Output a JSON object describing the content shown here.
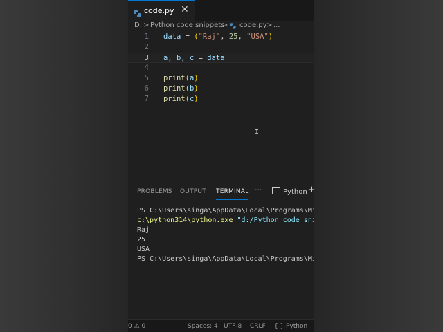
{
  "tab": {
    "filename": "code.py",
    "close": "✕"
  },
  "breadcrumb": {
    "drive": "D:",
    "sep": ">",
    "folder": "Python code snippets",
    "file": "code.py",
    "more": "..."
  },
  "editor": {
    "line_numbers": [
      "1",
      "2",
      "3",
      "4",
      "5",
      "6",
      "7"
    ],
    "current_line": "3",
    "lines": {
      "l1": {
        "var": "data",
        "eq": " = ",
        "open": "(",
        "s1": "\"Raj\"",
        "c1": ", ",
        "num": "25",
        "c2": ", ",
        "s2": "\"USA\"",
        "close": ")"
      },
      "l3": {
        "vars": "a, b, c",
        "eq": " = ",
        "var": "data"
      },
      "l5": {
        "fn": "print",
        "open": "(",
        "arg": "a",
        "close": ")"
      },
      "l6": {
        "fn": "print",
        "open": "(",
        "arg": "b",
        "close": ")"
      },
      "l7": {
        "fn": "print",
        "open": "(",
        "arg": "c",
        "close": ")"
      }
    },
    "mouse_cursor": "I"
  },
  "panel": {
    "tabs": [
      "PROBLEMS",
      "OUTPUT",
      "TERMINAL"
    ],
    "active_tab": "TERMINAL",
    "more": "···",
    "shell": "Python",
    "add": "+"
  },
  "terminal": {
    "prompt1": "PS C:\\Users\\singa\\AppData\\Local\\Programs\\Mic",
    "cmd_exe": "c:\\python314\\python.exe",
    "cmd_arg": " \"d:/Python code snip",
    "out1": "Raj",
    "out2": "25",
    "out3": "USA",
    "prompt2": "PS C:\\Users\\singa\\AppData\\Local\\Programs\\Mic"
  },
  "status": {
    "problems": "0 ⚠ 0",
    "spaces": "Spaces: 4",
    "encoding": "UTF-8",
    "eol": "CRLF",
    "braces": "{ }",
    "language": "Python"
  },
  "colors": {
    "accent": "#0078d4",
    "editor_bg": "#1f1f1f",
    "string": "#ce9178",
    "number": "#b5cea8",
    "function": "#dcdcaa",
    "variable": "#9cdcfe"
  }
}
